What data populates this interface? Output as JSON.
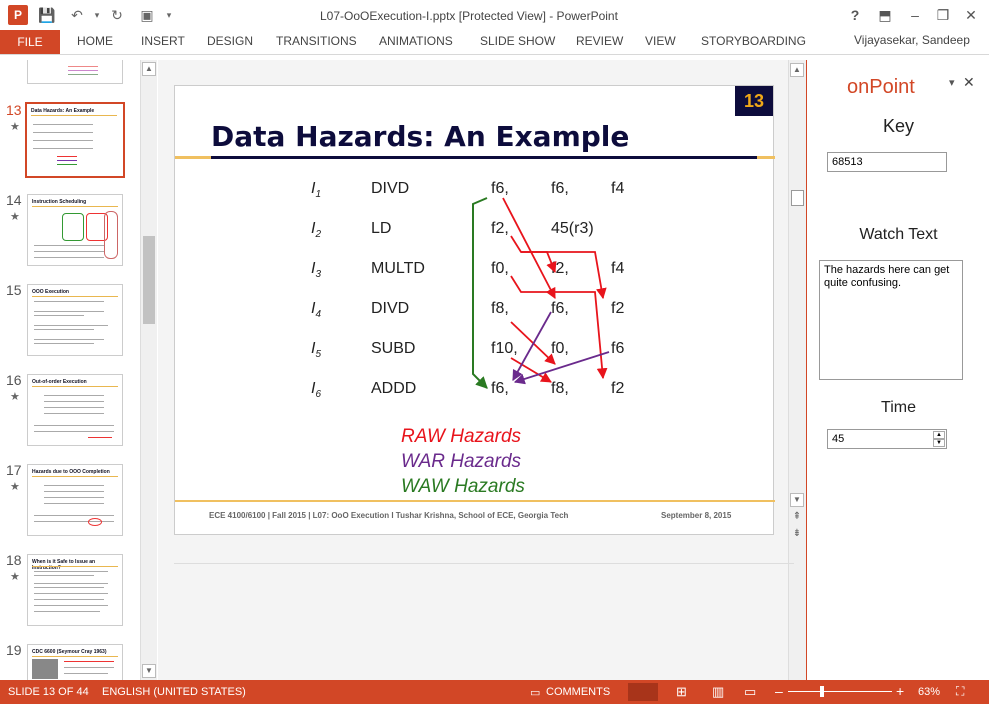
{
  "window": {
    "title": "L07-OoOExecution-I.pptx [Protected View] - PowerPoint",
    "help": "?",
    "user": "Vijayasekar, Sandeep"
  },
  "ribbon": {
    "file": "FILE",
    "tabs": [
      "HOME",
      "INSERT",
      "DESIGN",
      "TRANSITIONS",
      "ANIMATIONS",
      "SLIDE SHOW",
      "REVIEW",
      "VIEW",
      "STORYBOARDING"
    ]
  },
  "thumbnails": [
    {
      "num": "13",
      "star": "★",
      "title": "Data Hazards: An Example",
      "active": true
    },
    {
      "num": "14",
      "star": "★",
      "title": "Instruction Scheduling",
      "active": false
    },
    {
      "num": "15",
      "star": "",
      "title": "OOO Execution",
      "active": false
    },
    {
      "num": "16",
      "star": "★",
      "title": "Out-of-order Execution",
      "active": false
    },
    {
      "num": "17",
      "star": "★",
      "title": "Hazards due to OOO Completion",
      "active": false
    },
    {
      "num": "18",
      "star": "★",
      "title": "When is it Safe to Issue an Instruction?",
      "active": false
    },
    {
      "num": "19",
      "star": "",
      "title": "CDC 6600 (Seymour Cray 1963)",
      "active": false
    }
  ],
  "slide": {
    "number": "13",
    "title": "Data Hazards: An Example",
    "rows": [
      {
        "i": "I",
        "sub": "1",
        "op": "DIVD",
        "a": "f6,",
        "b": "f6,",
        "c": "f4"
      },
      {
        "i": "I",
        "sub": "2",
        "op": "LD",
        "a": "f2,",
        "b": "45(r3)",
        "c": ""
      },
      {
        "i": "I",
        "sub": "3",
        "op": "MULTD",
        "a": "f0,",
        "b": "f2,",
        "c": "f4"
      },
      {
        "i": "I",
        "sub": "4",
        "op": "DIVD",
        "a": "f8,",
        "b": "f6,",
        "c": "f2"
      },
      {
        "i": "I",
        "sub": "5",
        "op": "SUBD",
        "a": "f10,",
        "b": "f0,",
        "c": "f6"
      },
      {
        "i": "I",
        "sub": "6",
        "op": "ADDD",
        "a": "f6,",
        "b": "f8,",
        "c": "f2"
      }
    ],
    "legend": {
      "raw": "RAW Hazards",
      "war": "WAR Hazards",
      "waw": "WAW Hazards"
    },
    "footer": "ECE 4100/6100 | Fall 2015 | L07: OoO Execution I     Tushar Krishna, School of ECE, Georgia Tech",
    "date": "September 8, 2015",
    "colors": {
      "raw": "#e8141c",
      "war": "#6a2a8c",
      "waw": "#2a7a22",
      "navy": "#0d0c3c",
      "accent": "#d24726"
    }
  },
  "onpoint": {
    "title": "onPoint",
    "key_label": "Key",
    "key_value": "68513",
    "watch_label": "Watch Text",
    "watch_value": "The hazards here can get quite confusing.",
    "time_label": "Time",
    "time_value": "45"
  },
  "status": {
    "slide": "SLIDE 13 OF 44",
    "language": "ENGLISH (UNITED STATES)",
    "comments": "COMMENTS",
    "zoom": "63%"
  }
}
